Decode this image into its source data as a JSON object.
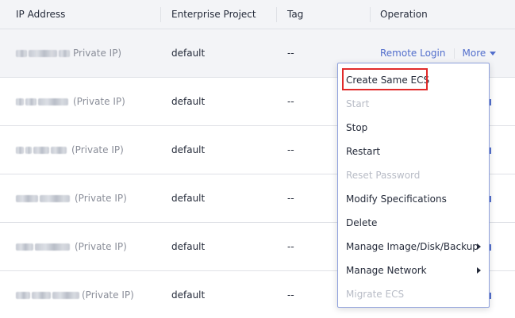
{
  "headers": {
    "ip": "IP Address",
    "project": "Enterprise Project",
    "tag": "Tag",
    "operation": "Operation"
  },
  "rows": [
    {
      "ip_suffix": "Private IP)",
      "project": "default",
      "tag": "--"
    },
    {
      "ip_suffix": "(Private IP)",
      "project": "default",
      "tag": "--"
    },
    {
      "ip_suffix": "(Private IP)",
      "project": "default",
      "tag": "--"
    },
    {
      "ip_suffix": "(Private IP)",
      "project": "default",
      "tag": "--"
    },
    {
      "ip_suffix": "(Private IP)",
      "project": "default",
      "tag": "--"
    },
    {
      "ip_suffix": "(Private IP)",
      "project": "default",
      "tag": "--"
    }
  ],
  "operation": {
    "remote_login": "Remote Login",
    "more": "More"
  },
  "menu": {
    "items": [
      {
        "label": "Create Same ECS",
        "disabled": false,
        "submenu": false
      },
      {
        "label": "Start",
        "disabled": true,
        "submenu": false
      },
      {
        "label": "Stop",
        "disabled": false,
        "submenu": false
      },
      {
        "label": "Restart",
        "disabled": false,
        "submenu": false
      },
      {
        "label": "Reset Password",
        "disabled": true,
        "submenu": false
      },
      {
        "label": "Modify Specifications",
        "disabled": false,
        "submenu": false
      },
      {
        "label": "Delete",
        "disabled": false,
        "submenu": false
      },
      {
        "label": "Manage Image/Disk/Backup",
        "disabled": false,
        "submenu": true
      },
      {
        "label": "Manage Network",
        "disabled": false,
        "submenu": true
      },
      {
        "label": "Migrate ECS",
        "disabled": true,
        "submenu": false
      }
    ]
  },
  "colors": {
    "link": "#526ecc",
    "highlight": "#e12a2a",
    "header_bg": "#f3f4f7"
  }
}
